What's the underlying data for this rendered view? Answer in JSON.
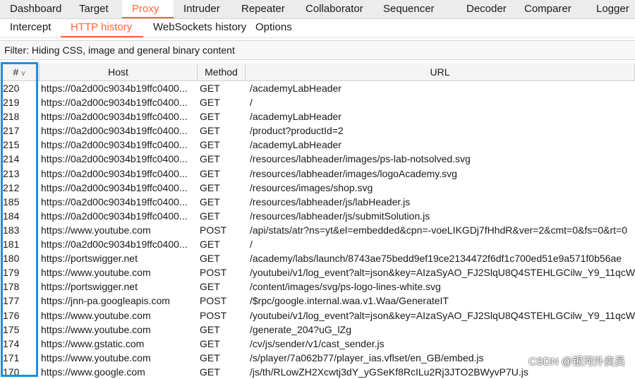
{
  "tabs": [
    "Dashboard",
    "Target",
    "Proxy",
    "Intruder",
    "Repeater",
    "Collaborator",
    "Sequencer",
    "Decoder",
    "Comparer",
    "Logger"
  ],
  "active_tab": "Proxy",
  "subtabs": [
    "Intercept",
    "HTTP history",
    "WebSockets history",
    "Options"
  ],
  "active_subtab": "HTTP history",
  "filter": "Filter: Hiding CSS, image and general binary content",
  "columns": {
    "num": "#",
    "host": "Host",
    "method": "Method",
    "url": "URL"
  },
  "rows": [
    {
      "num": "220",
      "host": "https://0a2d00c9034b19ffc0400...",
      "method": "GET",
      "url": "/academyLabHeader"
    },
    {
      "num": "219",
      "host": "https://0a2d00c9034b19ffc0400...",
      "method": "GET",
      "url": "/"
    },
    {
      "num": "218",
      "host": "https://0a2d00c9034b19ffc0400...",
      "method": "GET",
      "url": "/academyLabHeader"
    },
    {
      "num": "217",
      "host": "https://0a2d00c9034b19ffc0400...",
      "method": "GET",
      "url": "/product?productId=2"
    },
    {
      "num": "215",
      "host": "https://0a2d00c9034b19ffc0400...",
      "method": "GET",
      "url": "/academyLabHeader"
    },
    {
      "num": "214",
      "host": "https://0a2d00c9034b19ffc0400...",
      "method": "GET",
      "url": "/resources/labheader/images/ps-lab-notsolved.svg"
    },
    {
      "num": "213",
      "host": "https://0a2d00c9034b19ffc0400...",
      "method": "GET",
      "url": "/resources/labheader/images/logoAcademy.svg"
    },
    {
      "num": "212",
      "host": "https://0a2d00c9034b19ffc0400...",
      "method": "GET",
      "url": "/resources/images/shop.svg"
    },
    {
      "num": "185",
      "host": "https://0a2d00c9034b19ffc0400...",
      "method": "GET",
      "url": "/resources/labheader/js/labHeader.js"
    },
    {
      "num": "184",
      "host": "https://0a2d00c9034b19ffc0400...",
      "method": "GET",
      "url": "/resources/labheader/js/submitSolution.js"
    },
    {
      "num": "183",
      "host": "https://www.youtube.com",
      "method": "POST",
      "url": "/api/stats/atr?ns=yt&el=embedded&cpn=-voeLIKGDj7fHhdR&ver=2&cmt=0&fs=0&rt=0"
    },
    {
      "num": "181",
      "host": "https://0a2d00c9034b19ffc0400...",
      "method": "GET",
      "url": "/"
    },
    {
      "num": "180",
      "host": "https://portswigger.net",
      "method": "GET",
      "url": "/academy/labs/launch/8743ae75bedd9ef19ce2134472f6df1c700ed51e9a571f0b56ae"
    },
    {
      "num": "179",
      "host": "https://www.youtube.com",
      "method": "POST",
      "url": "/youtubei/v1/log_event?alt=json&key=AIzaSyAO_FJ2SlqU8Q4STEHLGCilw_Y9_11qcW"
    },
    {
      "num": "178",
      "host": "https://portswigger.net",
      "method": "GET",
      "url": "/content/images/svg/ps-logo-lines-white.svg"
    },
    {
      "num": "177",
      "host": "https://jnn-pa.googleapis.com",
      "method": "POST",
      "url": "/$rpc/google.internal.waa.v1.Waa/GenerateIT"
    },
    {
      "num": "176",
      "host": "https://www.youtube.com",
      "method": "POST",
      "url": "/youtubei/v1/log_event?alt=json&key=AIzaSyAO_FJ2SlqU8Q4STEHLGCilw_Y9_11qcW"
    },
    {
      "num": "175",
      "host": "https://www.youtube.com",
      "method": "GET",
      "url": "/generate_204?uG_lZg"
    },
    {
      "num": "174",
      "host": "https://www.gstatic.com",
      "method": "GET",
      "url": "/cv/js/sender/v1/cast_sender.js"
    },
    {
      "num": "171",
      "host": "https://www.youtube.com",
      "method": "GET",
      "url": "/s/player/7a062b77/player_ias.vflset/en_GB/embed.js"
    },
    {
      "num": "170",
      "host": "https://www.google.com",
      "method": "GET",
      "url": "/js/th/RLowZH2Xcwtj3dY_yGSeKf8RcILu2Rj3JTO2BWyvP7U.js"
    }
  ],
  "watermark": "CSDN @银河外卖员",
  "colors": {
    "accent": "#ff6633",
    "highlight": "#1a8fe0"
  }
}
